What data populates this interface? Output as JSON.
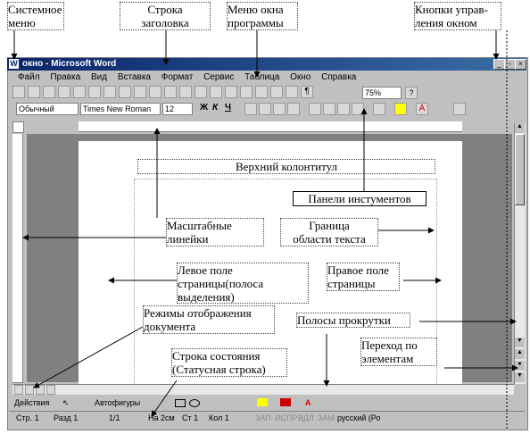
{
  "annotations": {
    "system_menu": [
      "Системное",
      "меню"
    ],
    "title_bar": [
      "Строка",
      "заголовка"
    ],
    "window_menu": [
      "Меню окна",
      "программы"
    ],
    "window_buttons": [
      "Кнопки управ-",
      "ления окном"
    ],
    "header": "Верхний колонтитул",
    "toolbars": "Панели инстументов",
    "rulers": [
      "Масштабные",
      "линейки"
    ],
    "text_border": [
      "Граница",
      "области текста"
    ],
    "left_margin": [
      "Левое поле",
      "страницы(полоса",
      "выделения)"
    ],
    "right_margin": [
      "Правое поле",
      "страницы"
    ],
    "view_modes": [
      "Режимы отображения",
      "документа"
    ],
    "scrollbars": "Полосы прокрутки",
    "status_bar": [
      "Строка состояния",
      "(Статусная строка)"
    ],
    "browse": [
      "Переход по",
      "элементам"
    ]
  },
  "window": {
    "title": "окно - Microsoft Word",
    "menu": [
      "Файл",
      "Правка",
      "Вид",
      "Вставка",
      "Формат",
      "Сервис",
      "Таблица",
      "Окно",
      "Справка"
    ],
    "zoom": "75%",
    "style": "Обычный",
    "font": "Times New Roman",
    "size": "12",
    "bold": "Ж",
    "italic": "К",
    "underline": "Ч"
  },
  "drawing_bar": {
    "actions": "Действия",
    "autoshapes": "Автофигуры"
  },
  "status": {
    "page": "Стр. 1",
    "section": "Разд 1",
    "pages": "1/1",
    "at": "На 2см",
    "line": "Ст 1",
    "col": "Кол 1",
    "rec": "ЗАП",
    "trk": "ИСПР",
    "ext": "ВДЛ",
    "ovr": "ЗАМ",
    "lang": "русский (Ро"
  }
}
